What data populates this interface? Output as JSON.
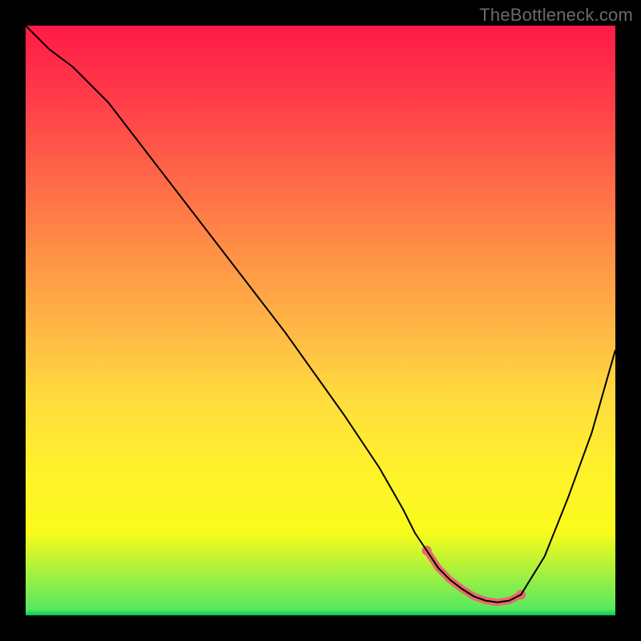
{
  "attribution": "TheBottleneck.com",
  "chart_data": {
    "type": "line",
    "title": "",
    "xlabel": "",
    "ylabel": "",
    "xlim": [
      0,
      100
    ],
    "ylim": [
      0,
      100
    ],
    "series": [
      {
        "name": "curve",
        "x": [
          0,
          4,
          8,
          14,
          24,
          34,
          44,
          54,
          60,
          64,
          66,
          68,
          70,
          72,
          74,
          76,
          78,
          80,
          82,
          84,
          88,
          92,
          96,
          100
        ],
        "values": [
          100,
          96,
          93,
          87,
          74,
          61,
          48,
          34,
          25,
          18,
          14,
          11,
          8,
          6,
          4.5,
          3.2,
          2.5,
          2.2,
          2.5,
          3.5,
          10,
          20,
          31,
          45
        ]
      },
      {
        "name": "markers",
        "x": [
          68,
          70,
          72,
          74,
          76,
          78,
          80,
          82,
          84
        ],
        "values": [
          11,
          8,
          6,
          4.5,
          3.2,
          2.5,
          2.2,
          2.5,
          3.5
        ]
      }
    ],
    "gradient_stops": [
      {
        "pos": 0,
        "color": "#ff1a46"
      },
      {
        "pos": 12,
        "color": "#ff3b4a"
      },
      {
        "pos": 26,
        "color": "#ff6848"
      },
      {
        "pos": 38,
        "color": "#ff8f46"
      },
      {
        "pos": 52,
        "color": "#ffb945"
      },
      {
        "pos": 64,
        "color": "#ffde3d"
      },
      {
        "pos": 76,
        "color": "#fff22a"
      },
      {
        "pos": 86,
        "color": "#f9fb1c"
      },
      {
        "pos": 99,
        "color": "#57e85f"
      },
      {
        "pos": 100,
        "color": "#00c853"
      }
    ],
    "colors": {
      "curve_stroke": "#000000",
      "marker_stroke": "#e86a6a",
      "marker_fill": "#e86a6a"
    }
  }
}
